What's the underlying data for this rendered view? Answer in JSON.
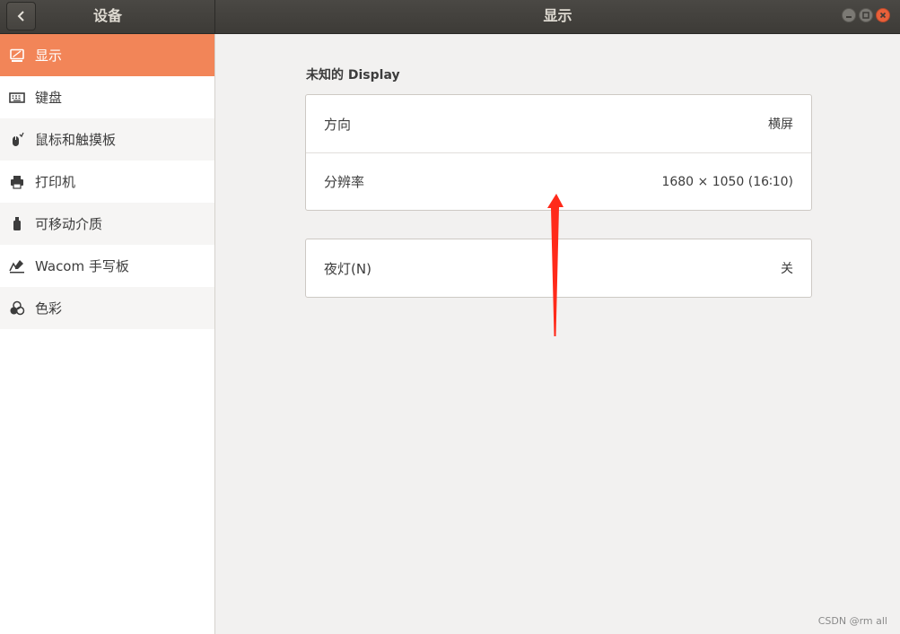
{
  "titlebar": {
    "sidebar_title": "设备",
    "main_title": "显示"
  },
  "sidebar": {
    "items": [
      {
        "label": "显示",
        "icon": "display-icon",
        "active": true
      },
      {
        "label": "键盘",
        "icon": "keyboard-icon"
      },
      {
        "label": "鼠标和触摸板",
        "icon": "mouse-icon"
      },
      {
        "label": "打印机",
        "icon": "printer-icon"
      },
      {
        "label": "可移动介质",
        "icon": "usb-icon"
      },
      {
        "label": "Wacom 手写板",
        "icon": "tablet-icon"
      },
      {
        "label": "色彩",
        "icon": "color-icon"
      }
    ]
  },
  "main": {
    "section_title": "未知的 Display",
    "display_panel": {
      "orientation": {
        "label": "方向",
        "value": "横屏"
      },
      "resolution": {
        "label": "分辨率",
        "value": "1680 × 1050 (16∶10)"
      }
    },
    "night_light": {
      "label": "夜灯(N)",
      "value": "关"
    }
  },
  "colors": {
    "accent": "#f28558",
    "titlebar": "#3d3b37",
    "close": "#e8603a",
    "annotation_arrow": "#ff2a1a"
  },
  "watermark": "CSDN @rm all"
}
